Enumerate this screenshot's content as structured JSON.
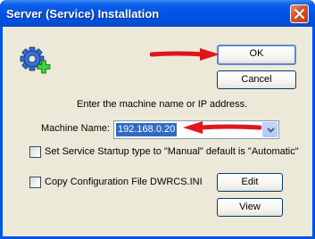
{
  "window": {
    "title": "Server (Service) Installation"
  },
  "buttons": {
    "ok_label": "OK",
    "cancel_label": "Cancel",
    "edit_label": "Edit",
    "view_label": "View"
  },
  "prompt": "Enter the machine name or IP address.",
  "machine_name": {
    "label": "Machine Name:",
    "value": "192.168.0.20"
  },
  "checkboxes": [
    {
      "label": "Set Service Startup type to \"Manual\" default is \"Automatic\"",
      "checked": false
    },
    {
      "label": "Copy Configuration File DWRCS.INI",
      "checked": false
    }
  ],
  "icons": {
    "app": "gear-add-icon",
    "close": "close-icon",
    "dropdown": "chevron-down-icon",
    "annotation": "red-arrow-icon"
  },
  "colors": {
    "titlebar": "#0054e3",
    "dialog_bg": "#ece9d8",
    "annotation_arrow": "#e0161c",
    "selection": "#316ac5"
  }
}
